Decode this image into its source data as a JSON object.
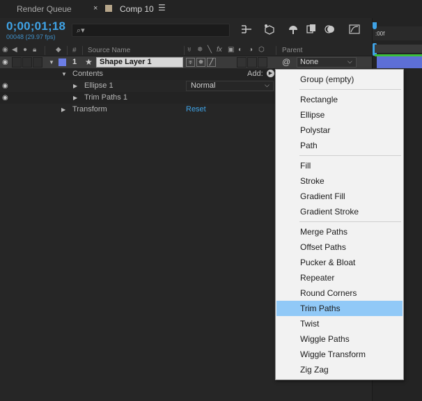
{
  "tabs": {
    "render_queue": "Render Queue",
    "comp_close": "×",
    "comp_label": "Comp 10",
    "comp_menu": "☰"
  },
  "timecode": "0;00;01;18",
  "frame_info": "00048 (29.97 fps)",
  "search": {
    "icon": "search-icon",
    "value": ""
  },
  "columns": {
    "num": "#",
    "source_name": "Source Name",
    "parent": "Parent"
  },
  "layer": {
    "number": "1",
    "name": "Shape Layer 1",
    "parent": "None",
    "label_color": "#6c7ee6"
  },
  "rows": {
    "contents": "Contents",
    "add_label": "Add:",
    "ellipse": "Ellipse 1",
    "ellipse_mode": "Normal",
    "trim_paths": "Trim Paths 1",
    "transform": "Transform",
    "reset": "Reset"
  },
  "timeline": {
    "ruler_label": ":00f"
  },
  "menu": {
    "groups": [
      [
        "Group (empty)"
      ],
      [
        "Rectangle",
        "Ellipse",
        "Polystar",
        "Path"
      ],
      [
        "Fill",
        "Stroke",
        "Gradient Fill",
        "Gradient Stroke"
      ],
      [
        "Merge Paths",
        "Offset Paths",
        "Pucker & Bloat",
        "Repeater",
        "Round Corners",
        "Trim Paths",
        "Twist",
        "Wiggle Paths",
        "Wiggle Transform",
        "Zig Zag"
      ]
    ],
    "highlighted": "Trim Paths",
    "highlight_color": "#91c9f7"
  },
  "colors": {
    "accent": "#3fa3e6",
    "background": "#232323"
  }
}
